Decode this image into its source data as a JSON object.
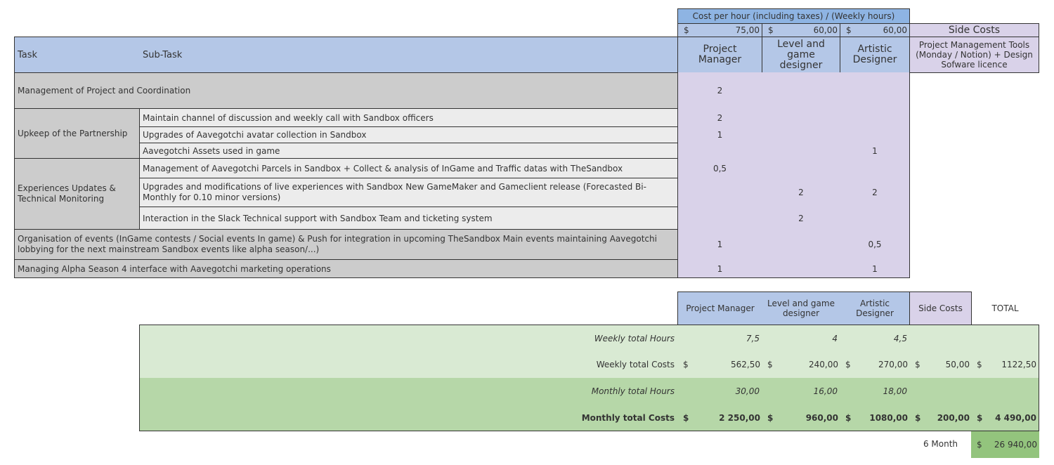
{
  "header": {
    "rate_title": "Cost per hour (including taxes) / (Weekly hours)",
    "currency": "$",
    "rates": [
      "75,00",
      "60,00",
      "60,00"
    ],
    "side_costs_title": "Side Costs",
    "col_task": "Task",
    "col_subtask": "Sub-Task",
    "col_pm": "Project Manager",
    "col_lgd": "Level and game designer",
    "col_ad": "Artistic Designer",
    "col_side": "Project Management Tools (Monday / Notion) + Design Sofware licence"
  },
  "rows": {
    "management": {
      "task": "Management of Project and Coordination",
      "pm": "2"
    },
    "partnership": {
      "task": "Upkeep of the Partnership",
      "subs": [
        {
          "label": "Maintain channel of discussion and weekly call with Sandbox officers",
          "pm": "2",
          "ad": ""
        },
        {
          "label": "Upgrades of Aavegotchi avatar collection in Sandbox",
          "pm": "1",
          "ad": ""
        },
        {
          "label": "Aavegotchi Assets used in game",
          "pm": "",
          "ad": "1"
        }
      ]
    },
    "experiences": {
      "task": "Experiences Updates & Technical Monitoring",
      "subs": [
        {
          "label": "Management of Aavegotchi Parcels in Sandbox + Collect & analysis of InGame and Traffic datas with TheSandbox",
          "pm": "0,5",
          "lgd": "",
          "ad": ""
        },
        {
          "label": "Upgrades and modifications of live experiences with Sandbox New GameMaker and Gameclient release (Forecasted Bi-Monthly for 0.10 minor versions)",
          "pm": "",
          "lgd": "2",
          "ad": "2"
        },
        {
          "label": "Interaction in the Slack Technical support with Sandbox Team and ticketing system",
          "pm": "",
          "lgd": "2",
          "ad": ""
        }
      ]
    },
    "events": {
      "task": "Organisation of events (InGame contests / Social events In game) & Push for integration in upcoming TheSandbox Main events maintaining Aavegotchi lobbying for the next mainstream Sandbox events like alpha season/...)",
      "pm": "1",
      "ad": "0,5"
    },
    "alpha": {
      "task": "Managing Alpha Season 4 interface with Aavegotchi marketing operations",
      "pm": "1",
      "ad": "1"
    }
  },
  "summary": {
    "headers": {
      "pm": "Project Manager",
      "lgd": "Level and game designer",
      "ad": "Artistic Designer",
      "side": "Side Costs",
      "total": "TOTAL"
    },
    "weekly_hours": {
      "label": "Weekly total Hours",
      "pm": "7,5",
      "lgd": "4",
      "ad": "4,5"
    },
    "weekly_costs": {
      "label": "Weekly total Costs",
      "pm": "562,50",
      "lgd": "240,00",
      "ad": "270,00",
      "side": "50,00",
      "total": "1122,50"
    },
    "monthly_hours": {
      "label": "Monthly total Hours",
      "pm": "30,00",
      "lgd": "16,00",
      "ad": "18,00"
    },
    "monthly_costs": {
      "label": "Monthly total Costs",
      "pm": "2 250,00",
      "lgd": "960,00",
      "ad": "1080,00",
      "side": "200,00",
      "total": "4 490,00"
    },
    "six_month": {
      "label": "6 Month",
      "total": "26 940,00"
    }
  },
  "colors": {
    "header_blue": "#b4c7e7",
    "rate_blue": "#8eb4e3",
    "lavender": "#d9d2e9",
    "task_grey": "#cccccc",
    "sub_grey": "#ececec",
    "green_light": "#d9ead3",
    "green_mid": "#b6d7a8",
    "green_dark": "#93c47d"
  }
}
